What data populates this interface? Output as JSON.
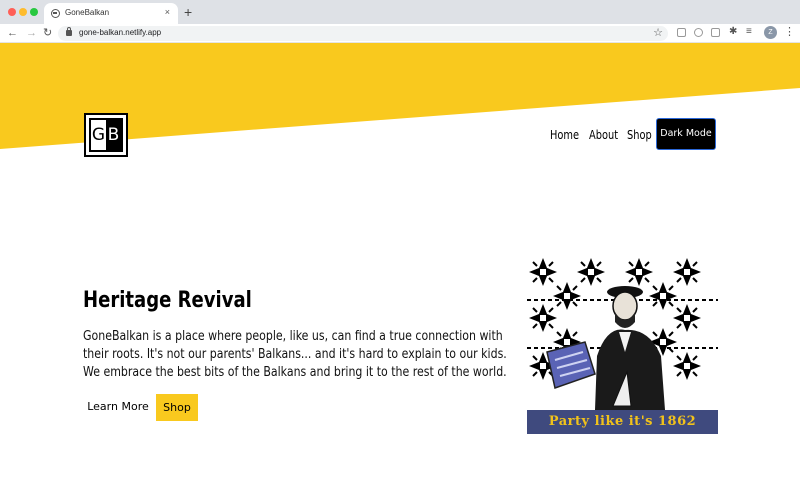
{
  "browser": {
    "tab_title": "GoneBalkan",
    "tab_close": "×",
    "new_tab": "+",
    "url": "gone-balkan.netlify.app",
    "back": "←",
    "forward": "→",
    "reload": "↻",
    "star": "☆",
    "puzzle": "✱",
    "list": "≡",
    "avatar_letter": "Z",
    "menu": "⋮"
  },
  "site": {
    "logo": {
      "left": "G",
      "right": "B"
    },
    "nav": {
      "home": "Home",
      "about": "About",
      "shop": "Shop",
      "dark_mode": "Dark Mode"
    },
    "hero": {
      "title": "Heritage Revival",
      "text": "GoneBalkan is a place where people, like us, can find a true connection with their roots. It's not our parents' Balkans... and it's hard to explain to our kids. We embrace the best bits of the Balkans and bring it to the rest of the world.",
      "learn_more": "Learn More",
      "shop": "Shop"
    },
    "poster_caption": "Party like it's 1862"
  },
  "colors": {
    "accent_yellow": "#f9c91e",
    "dark_button_border": "#2b68d9",
    "poster_banner": "#3f4a7e"
  }
}
